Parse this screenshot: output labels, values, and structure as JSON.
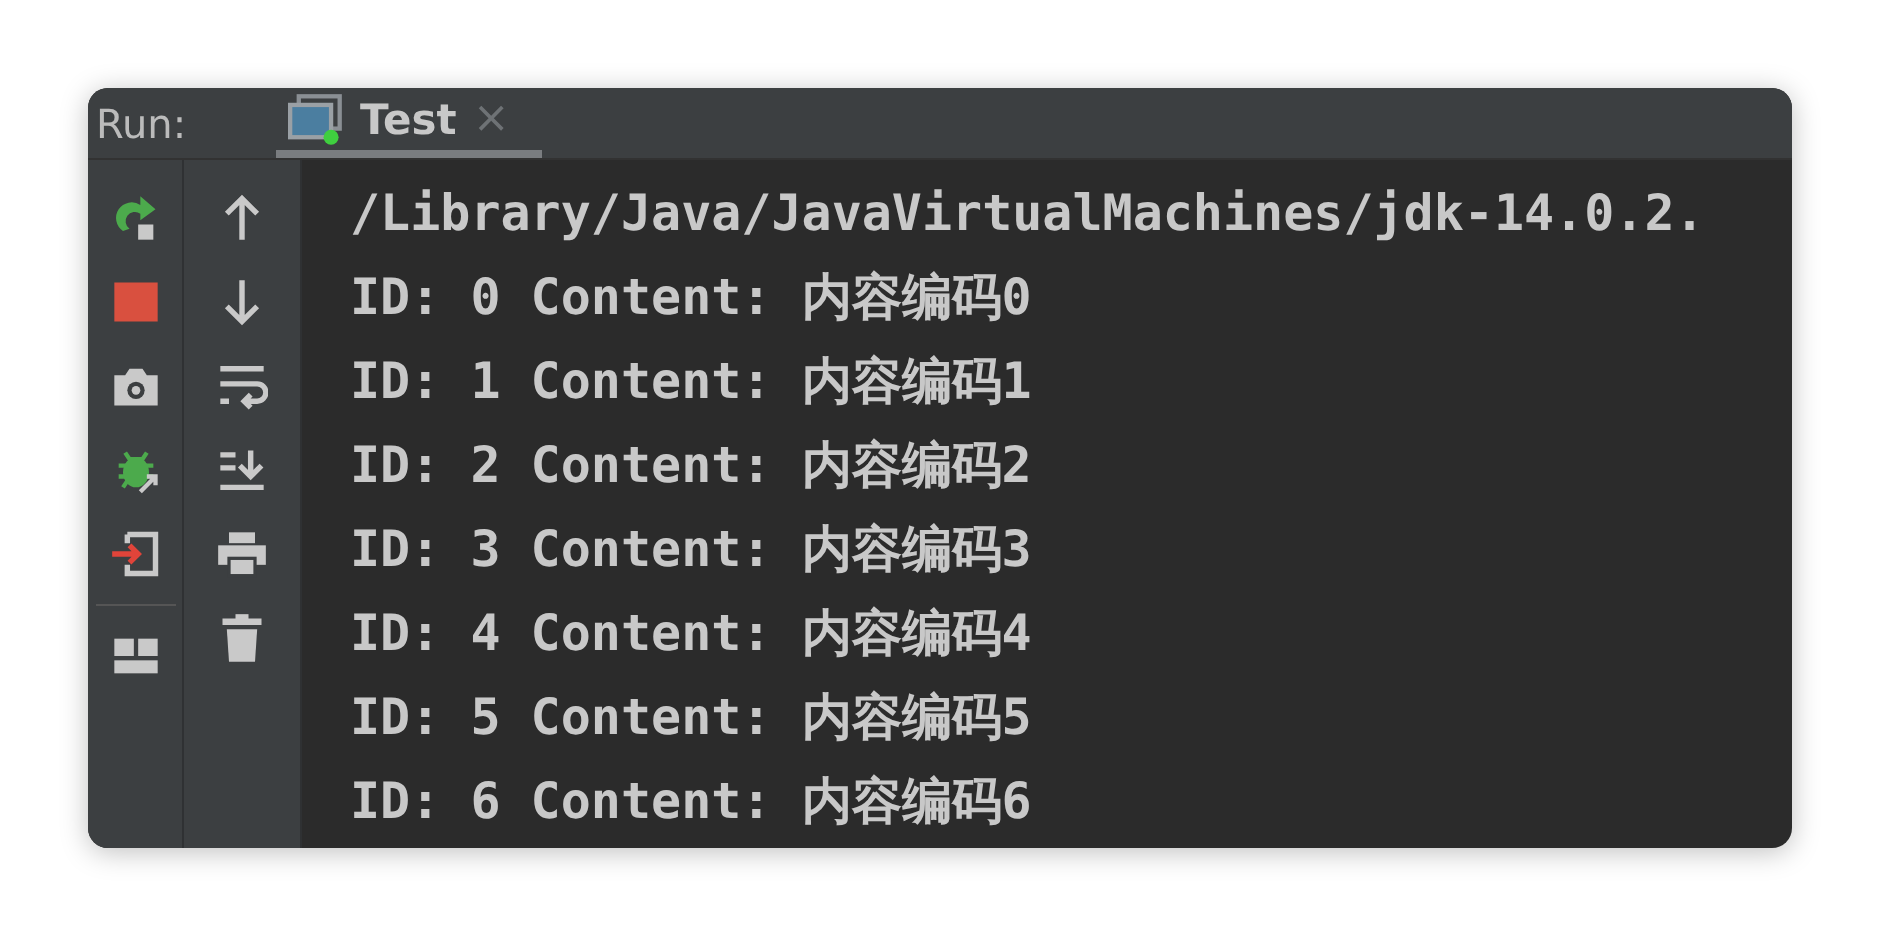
{
  "header": {
    "label": "Run:"
  },
  "tabs": [
    {
      "title": "Test",
      "close": "×",
      "selected": true
    }
  ],
  "console": {
    "lines": [
      "/Library/Java/JavaVirtualMachines/jdk-14.0.2.",
      "ID: 0 Content: 内容编码0",
      "ID: 1 Content: 内容编码1",
      "ID: 2 Content: 内容编码2",
      "ID: 3 Content: 内容编码3",
      "ID: 4 Content: 内容编码4",
      "ID: 5 Content: 内容编码5",
      "ID: 6 Content: 内容编码6"
    ]
  }
}
